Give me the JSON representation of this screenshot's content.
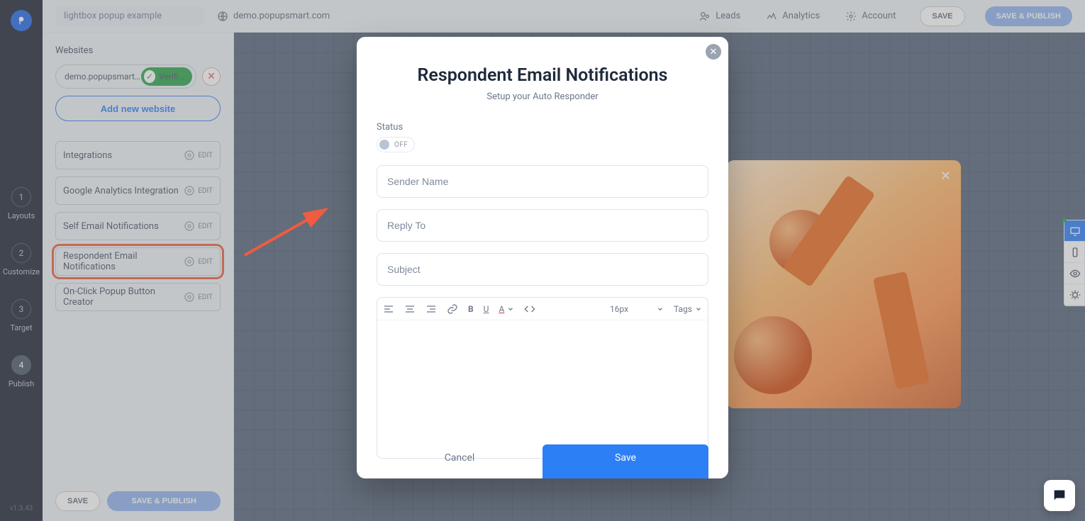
{
  "topbar": {
    "project_name": "lightbox popup example",
    "site": "demo.popupsmart.com",
    "leads": "Leads",
    "analytics": "Analytics",
    "account": "Account",
    "save": "SAVE",
    "save_publish": "SAVE & PUBLISH"
  },
  "rail": {
    "steps": [
      {
        "num": "1",
        "label": "Layouts"
      },
      {
        "num": "2",
        "label": "Customize"
      },
      {
        "num": "3",
        "label": "Target"
      },
      {
        "num": "4",
        "label": "Publish"
      }
    ],
    "version": "v1.3.43"
  },
  "sidepanel": {
    "websites_label": "Websites",
    "site_name": "demo.popupsmart.c...",
    "verified": "Verified",
    "add_website": "Add new website",
    "items": [
      {
        "label": "Integrations",
        "edit": "EDIT"
      },
      {
        "label": "Google Analytics Integration",
        "edit": "EDIT"
      },
      {
        "label": "Self Email Notifications",
        "edit": "EDIT"
      },
      {
        "label": "Respondent Email Notifications",
        "edit": "EDIT"
      },
      {
        "label": "On-Click Popup Button Creator",
        "edit": "EDIT"
      }
    ],
    "footer_save": "SAVE",
    "footer_publish": "SAVE & PUBLISH"
  },
  "modal": {
    "title": "Respondent Email Notifications",
    "subtitle": "Setup your Auto Responder",
    "status_label": "Status",
    "status_state": "OFF",
    "sender_placeholder": "Sender Name",
    "reply_placeholder": "Reply To",
    "subject_placeholder": "Subject",
    "font_size": "16px",
    "tags": "Tags",
    "cancel": "Cancel",
    "save": "Save"
  }
}
